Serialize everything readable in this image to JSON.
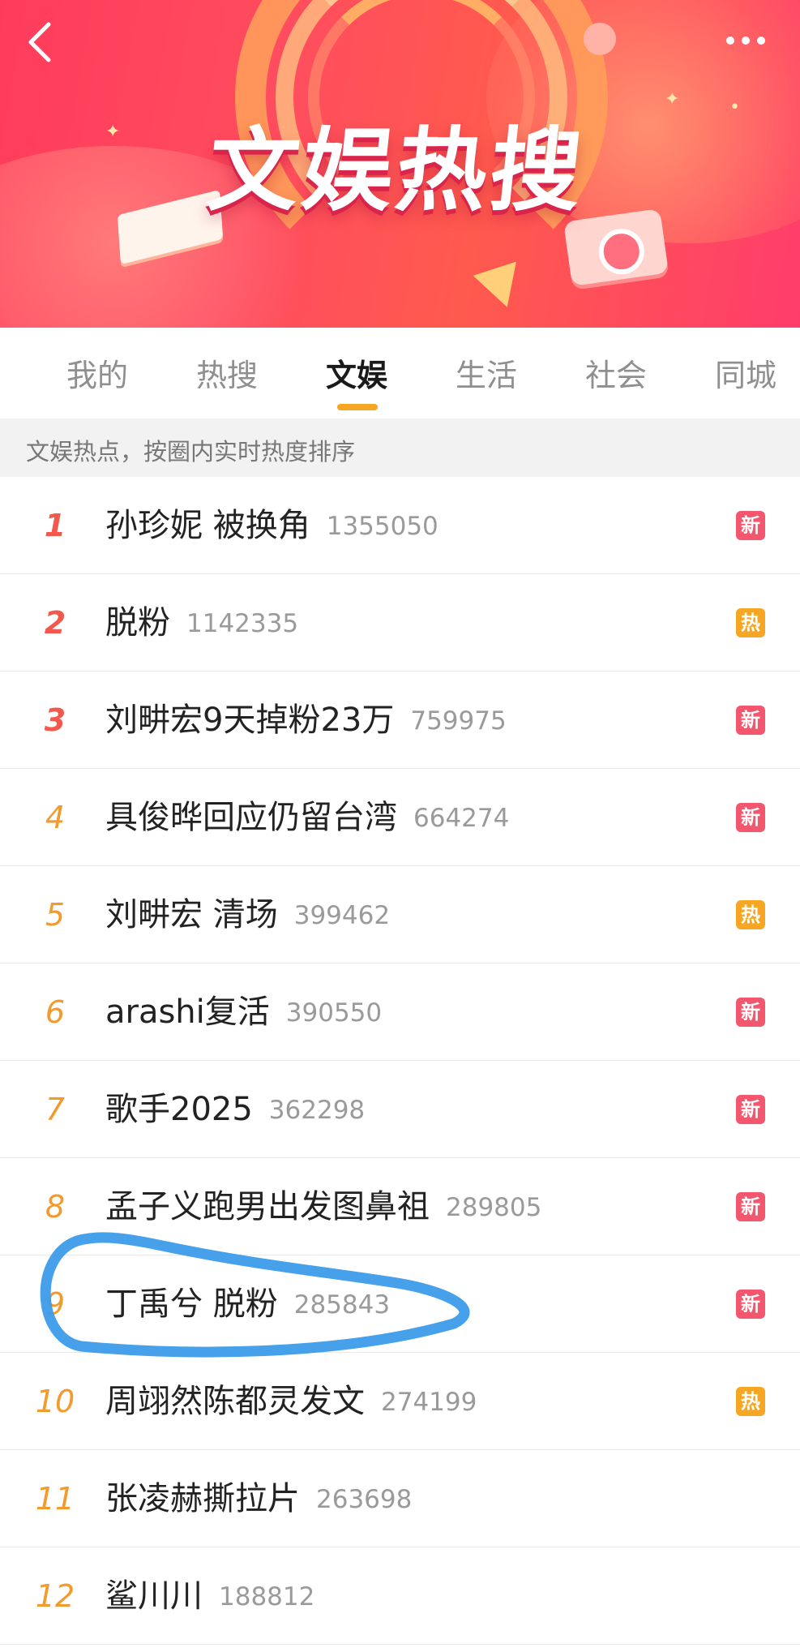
{
  "banner": {
    "title": "文娱热搜",
    "back_icon": "chevron-left-icon",
    "more_icon": "more-dots-icon"
  },
  "tabs": [
    {
      "label": "我的",
      "active": false
    },
    {
      "label": "热搜",
      "active": false
    },
    {
      "label": "文娱",
      "active": true
    },
    {
      "label": "生活",
      "active": false
    },
    {
      "label": "社会",
      "active": false
    },
    {
      "label": "同城",
      "active": false
    }
  ],
  "subtitle": "文娱热点，按圈内实时热度排序",
  "list": [
    {
      "rank": "1",
      "title": "孙珍妮 被换角",
      "count": "1355050",
      "badge": "新",
      "badge_type": "new"
    },
    {
      "rank": "2",
      "title": "脱粉",
      "count": "1142335",
      "badge": "热",
      "badge_type": "hot"
    },
    {
      "rank": "3",
      "title": "刘畊宏9天掉粉23万",
      "count": "759975",
      "badge": "新",
      "badge_type": "new"
    },
    {
      "rank": "4",
      "title": "具俊晔回应仍留台湾",
      "count": "664274",
      "badge": "新",
      "badge_type": "new"
    },
    {
      "rank": "5",
      "title": "刘畊宏 清场",
      "count": "399462",
      "badge": "热",
      "badge_type": "hot"
    },
    {
      "rank": "6",
      "title": "arashi复活",
      "count": "390550",
      "badge": "新",
      "badge_type": "new"
    },
    {
      "rank": "7",
      "title": "歌手2025",
      "count": "362298",
      "badge": "新",
      "badge_type": "new"
    },
    {
      "rank": "8",
      "title": "孟子义跑男出发图鼻祖",
      "count": "289805",
      "badge": "新",
      "badge_type": "new"
    },
    {
      "rank": "9",
      "title": "丁禹兮 脱粉",
      "count": "285843",
      "badge": "新",
      "badge_type": "new"
    },
    {
      "rank": "10",
      "title": "周翊然陈都灵发文",
      "count": "274199",
      "badge": "热",
      "badge_type": "hot"
    },
    {
      "rank": "11",
      "title": "张凌赫撕拉片",
      "count": "263698",
      "badge": "",
      "badge_type": ""
    },
    {
      "rank": "12",
      "title": "鲨川川",
      "count": "188812",
      "badge": "",
      "badge_type": ""
    }
  ],
  "colors": {
    "accent": "#f5a623",
    "rank_top": "#f2584b",
    "rank_other": "#f39a2d",
    "badge_new": "#f2576e",
    "badge_hot": "#f6a623",
    "annotation": "#3d9be9"
  }
}
